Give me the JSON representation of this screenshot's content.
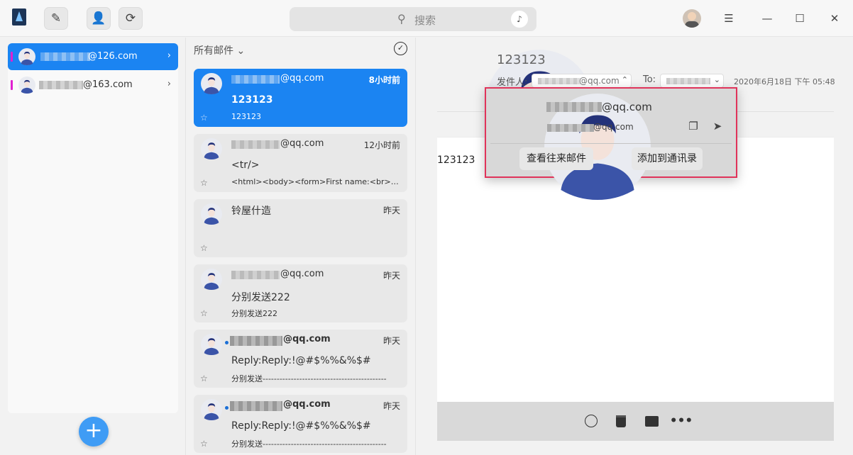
{
  "toolbar": {
    "compose_icon": "compose-icon",
    "contacts_icon": "contacts-icon",
    "refresh_icon": "refresh-icon"
  },
  "search": {
    "placeholder": "搜索"
  },
  "window": {
    "menu_glyph": "☰",
    "minimize_glyph": "—",
    "maximize_glyph": "☐",
    "close_glyph": "✕"
  },
  "accounts": [
    {
      "name": "@126.com",
      "active": true
    },
    {
      "name": "@163.com",
      "active": false
    }
  ],
  "add_account_label": "+",
  "mail_list": {
    "folder": "所有邮件 ⌄",
    "items": [
      {
        "from": "@qq.com",
        "time": "8小时前",
        "subject": "123123",
        "preview": "123123",
        "active": true,
        "unread": false
      },
      {
        "from": "@qq.com",
        "time": "12小时前",
        "subject": "<tr/>",
        "preview": "<html><body><form>First name:<br><input type=\"text\">",
        "active": false,
        "unread": false
      },
      {
        "from": "铃屋什造",
        "time": "昨天",
        "subject": "",
        "preview": "",
        "active": false,
        "unread": false
      },
      {
        "from": "@qq.com",
        "time": "昨天",
        "subject": "分别发送222",
        "preview": "分别发送222",
        "active": false,
        "unread": false
      },
      {
        "from": "@qq.com",
        "time": "昨天",
        "subject": "Reply:Reply:!@#$%%&%$#",
        "preview": "分别发送--------------------------------------------",
        "active": false,
        "unread": true
      },
      {
        "from": "@qq.com",
        "time": "昨天",
        "subject": "Reply:Reply:!@#$%%&%$#",
        "preview": "分别发送--------------------------------------------",
        "active": false,
        "unread": true
      }
    ]
  },
  "reader": {
    "subject": "123123",
    "sender_label": "发件人:",
    "sender_email": "@qq.com",
    "to_label": "To:",
    "date": "2020年6月18日 下午 05:48",
    "body": "123123"
  },
  "popover": {
    "email_primary": "@qq.com",
    "email_secondary": "@qq.com",
    "view_mails_label": "查看往来邮件",
    "add_contact_label": "添加到通讯录"
  },
  "colors": {
    "accent": "#1b84f2",
    "account_marker": "#e020d0",
    "popover_border": "#e0335a",
    "avatar": "#3b54a8"
  }
}
